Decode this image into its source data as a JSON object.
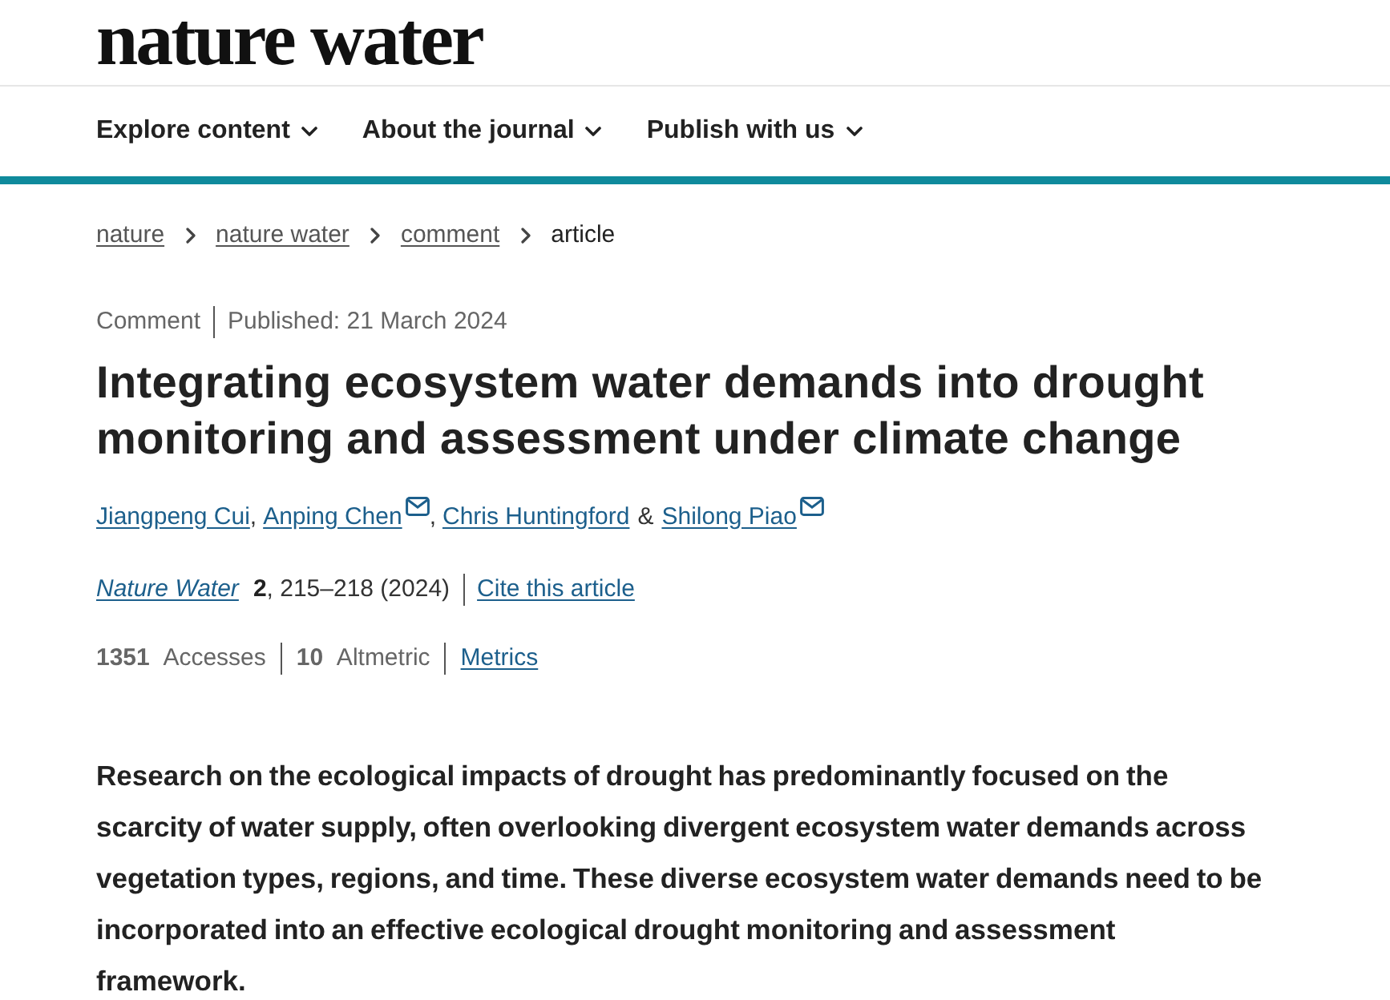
{
  "header": {
    "logo": "nature water",
    "nav": [
      {
        "label": "Explore content"
      },
      {
        "label": "About the journal"
      },
      {
        "label": "Publish with us"
      }
    ]
  },
  "breadcrumb": [
    {
      "label": "nature",
      "kind": "link"
    },
    {
      "label": "nature water",
      "kind": "link"
    },
    {
      "label": "comment",
      "kind": "link"
    },
    {
      "label": "article",
      "kind": "current"
    }
  ],
  "article": {
    "type": "Comment",
    "published": "Published: 21 March 2024",
    "title": "Integrating ecosystem water demands into drought monitoring and assessment under climate change",
    "authors": [
      {
        "name": "Jiangpeng Cui",
        "email": false,
        "after": ","
      },
      {
        "name": "Anping Chen",
        "email": true,
        "after": ","
      },
      {
        "name": "Chris Huntingford",
        "email": false,
        "after": "&"
      },
      {
        "name": "Shilong Piao",
        "email": true
      }
    ],
    "citation": {
      "journal": "Nature Water",
      "volume": "2",
      "pages": ", 215–218 (2024)",
      "cite_link": "Cite this article"
    },
    "metrics": [
      "**1351** Accesses",
      "**10** Altmetric"
    ],
    "metrics_link": "Metrics",
    "abstract": "Research on the ecological impacts of drought has predominantly focused on the scarcity of water supply, often overlooking divergent ecosystem water demands across vegetation types, regions, and time. These diverse ecosystem water demands need to be incorporated into an effective ecological drought monitoring and assessment framework."
  }
}
